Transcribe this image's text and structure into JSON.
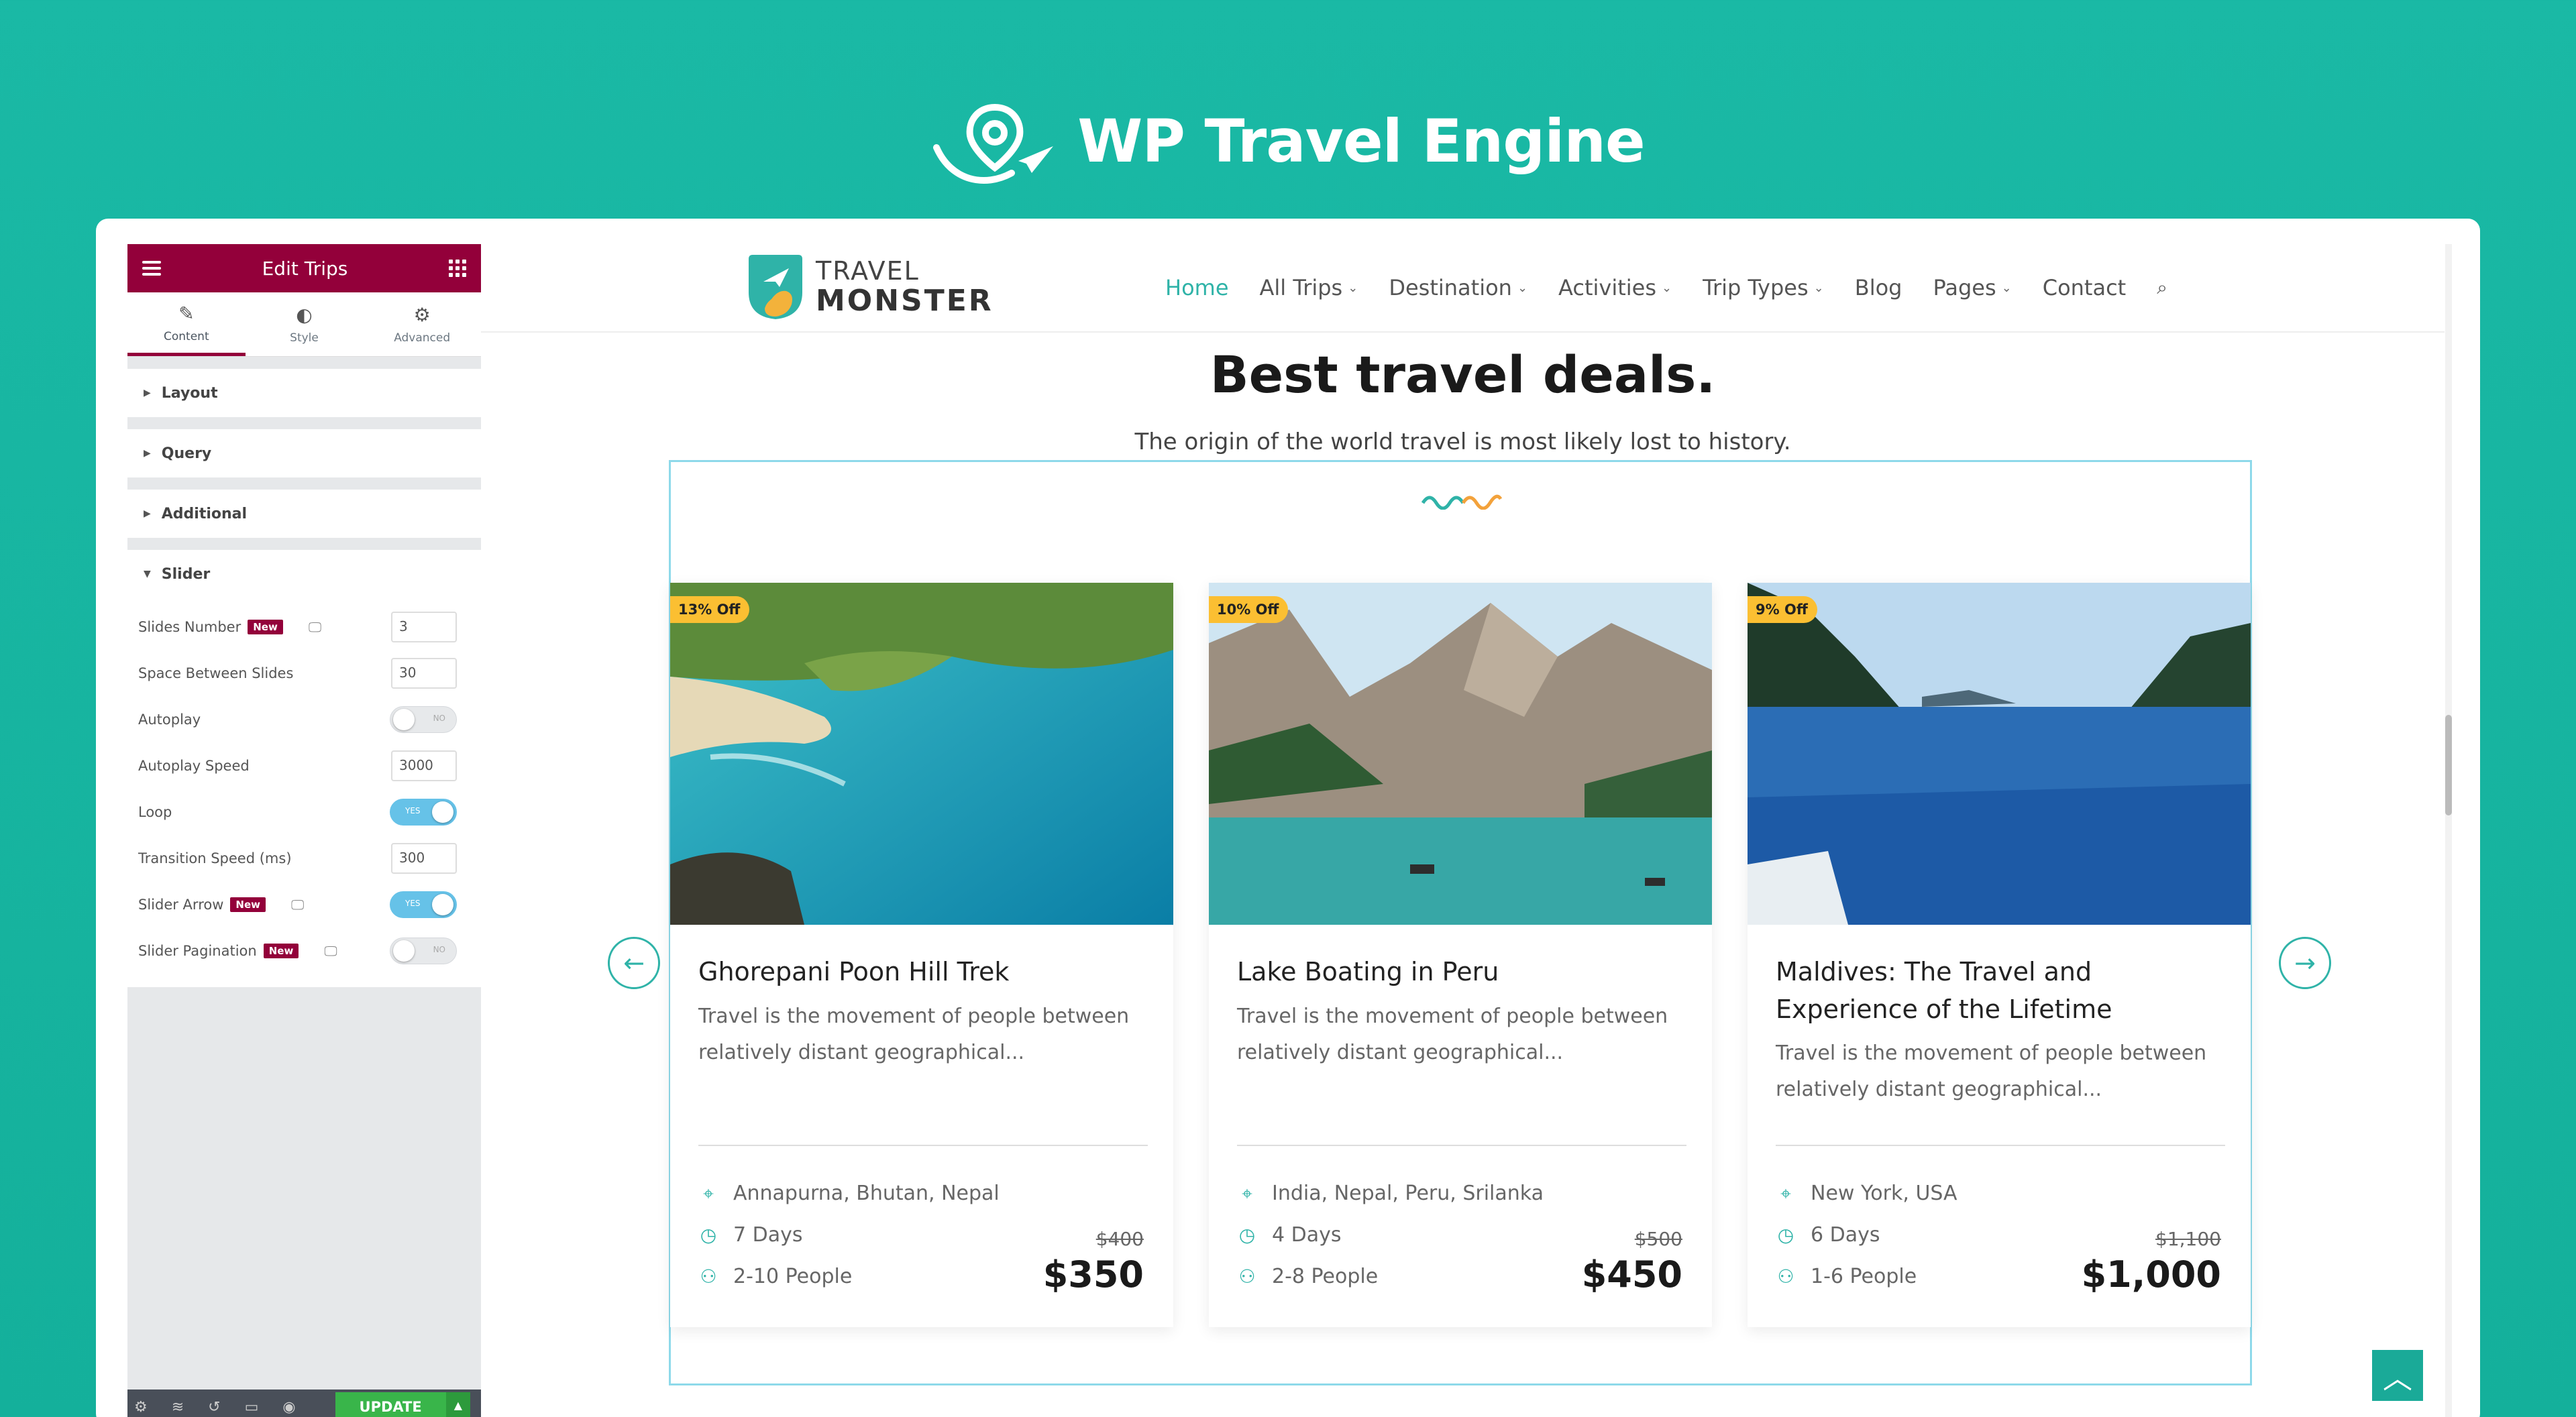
{
  "brand": {
    "title": "WP Travel Engine",
    "logo_icon": "map-pin-plane-icon"
  },
  "editor": {
    "title": "Edit Trips",
    "tabs": [
      {
        "label": "Content",
        "icon": "pencil-icon"
      },
      {
        "label": "Style",
        "icon": "half-circle-icon"
      },
      {
        "label": "Advanced",
        "icon": "gear-icon"
      }
    ],
    "sections": [
      "Layout",
      "Query",
      "Additional",
      "Slider"
    ],
    "badge": "New",
    "controls": {
      "slides_number": {
        "label": "Slides Number",
        "value": "3"
      },
      "space_between": {
        "label": "Space Between Slides",
        "value": "30"
      },
      "autoplay": {
        "label": "Autoplay",
        "state": "NO"
      },
      "autoplay_speed": {
        "label": "Autoplay Speed",
        "value": "3000"
      },
      "loop": {
        "label": "Loop",
        "state": "YES"
      },
      "transition_speed": {
        "label": "Transition Speed (ms)",
        "value": "300"
      },
      "slider_arrow": {
        "label": "Slider Arrow",
        "state": "YES"
      },
      "slider_pagination": {
        "label": "Slider Pagination",
        "state": "NO"
      }
    },
    "update_label": "UPDATE",
    "colors": {
      "header": "#93003a",
      "update": "#39b54a",
      "toggle_on": "#66c2e8"
    }
  },
  "site": {
    "logo": {
      "line1": "TRAVEL",
      "line2": "MONSTER"
    },
    "nav": [
      {
        "label": "Home",
        "active": true
      },
      {
        "label": "All Trips",
        "dropdown": true
      },
      {
        "label": "Destination",
        "dropdown": true
      },
      {
        "label": "Activities",
        "dropdown": true
      },
      {
        "label": "Trip Types",
        "dropdown": true
      },
      {
        "label": "Blog"
      },
      {
        "label": "Pages",
        "dropdown": true
      },
      {
        "label": "Contact"
      }
    ],
    "heading": "Best travel deals.",
    "subheading": "The origin of the world travel is most likely lost to history.",
    "accent": "#2fb3a8",
    "trips": [
      {
        "discount": "13% Off",
        "title": "Ghorepani Poon Hill Trek",
        "desc": "Travel is the movement of people between relatively distant geographical...",
        "location": "Annapurna, Bhutan, Nepal",
        "duration": "7 Days",
        "group": "2-10 People",
        "old_price": "$400",
        "price": "$350"
      },
      {
        "discount": "10% Off",
        "title": "Lake Boating in Peru",
        "desc": "Travel is the movement of people between relatively distant geographical...",
        "location": "India, Nepal, Peru, Srilanka",
        "duration": "4 Days",
        "group": "2-8 People",
        "old_price": "$500",
        "price": "$450"
      },
      {
        "discount": "9% Off",
        "title": "Maldives: The Travel and Experience of the Lifetime",
        "desc": "Travel is the movement of people between relatively distant geographical...",
        "location": "New York, USA",
        "duration": "6 Days",
        "group": "1-6 People",
        "old_price": "$1,100",
        "price": "$1,000"
      }
    ]
  }
}
